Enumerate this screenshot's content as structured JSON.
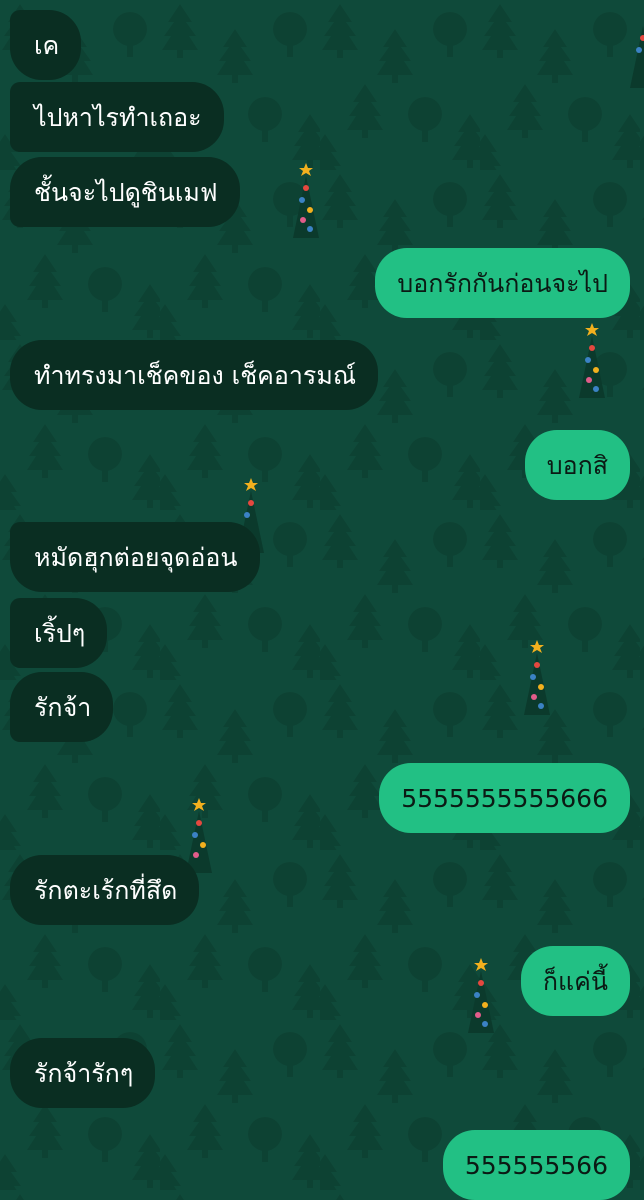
{
  "chat": {
    "colors": {
      "background": "#0f4a3a",
      "incoming_bubble": "#0a2e22",
      "outgoing_bubble": "#22c084"
    },
    "messages": [
      {
        "side": "in",
        "text": "เค"
      },
      {
        "side": "in",
        "text": "ไปหาไรทำเถอะ"
      },
      {
        "side": "in",
        "text": "ชั้นจะไปดูชินเมฟ"
      },
      {
        "side": "out",
        "text": "บอกรักกันก่อนจะไป"
      },
      {
        "side": "in",
        "text": "ทำทรงมาเช็คของ เช็คอารมณ์"
      },
      {
        "side": "out",
        "text": "บอกสิ"
      },
      {
        "side": "in",
        "text": "หมัดฮุกต่อยจุดอ่อน"
      },
      {
        "side": "in",
        "text": "เริ้ปๆ"
      },
      {
        "side": "in",
        "text": "รักจ้า"
      },
      {
        "side": "out",
        "text": "5555555555666"
      },
      {
        "side": "in",
        "text": "รักตะเร้กที่สึด"
      },
      {
        "side": "out",
        "text": "ก็แค่นี้"
      },
      {
        "side": "in",
        "text": "รักจ้ารักๆ"
      },
      {
        "side": "out",
        "text": "555555566"
      }
    ],
    "decorations": [
      "christmas-tree-icon"
    ]
  }
}
